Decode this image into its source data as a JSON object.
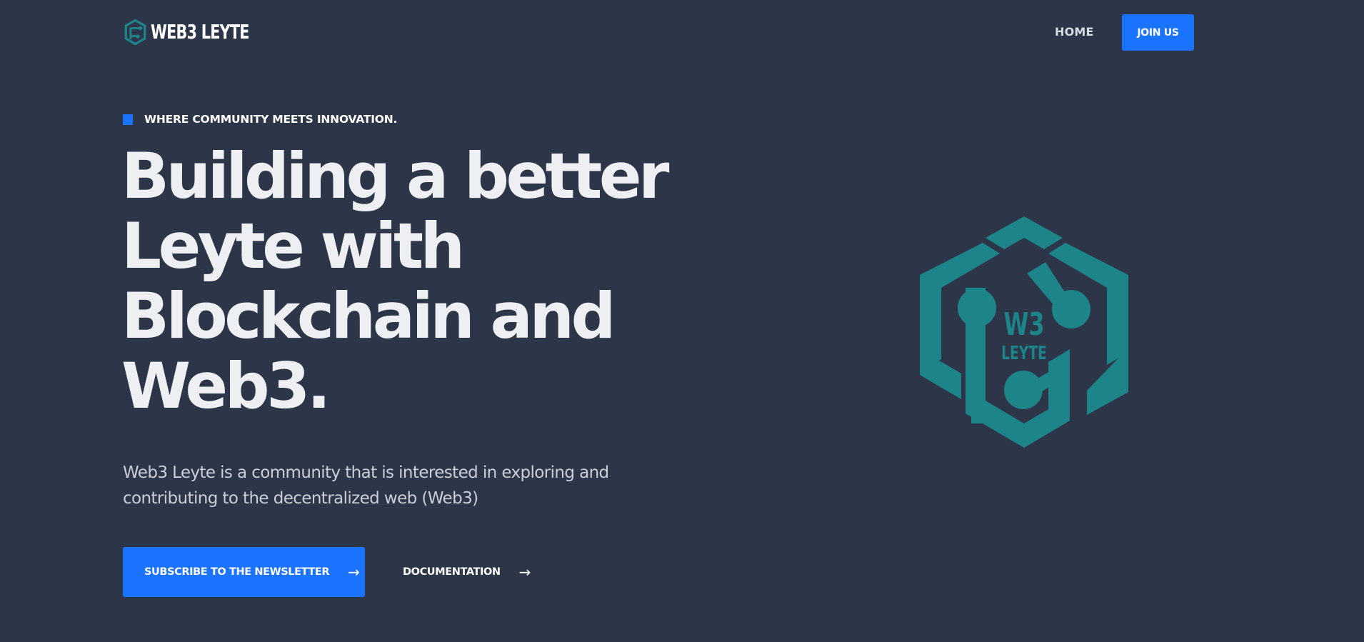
{
  "nav": {
    "brand": "WEB3 LEYTE",
    "home_label": "HOME",
    "join_label": "JOIN US"
  },
  "hero": {
    "eyebrow": "WHERE COMMUNITY MEETS INNOVATION.",
    "headline_lines": [
      "Building a better",
      "Leyte with",
      "Blockchain and",
      "Web3."
    ],
    "lead_lines": [
      "Web3 Leyte is a community that is interested in exploring and",
      "contributing to the decentralized web (Web3)"
    ],
    "subscribe_label": "SUBSCRIBE TO THE NEWSLETTER",
    "docs_label": "DOCUMENTATION",
    "arrow_glyph": "→",
    "logo_text_top": "W3",
    "logo_text_bottom": "LEYTE"
  },
  "colors": {
    "background": "#2d3648",
    "accent": "#1a74ff",
    "logo_teal": "#1d8489",
    "text": "#eef0f4"
  },
  "icons": {
    "nav_logo": "web3-leyte-hexagon-icon",
    "hero_logo": "web3-leyte-hexagon-logo",
    "eyebrow": "blue-square-bullet-icon",
    "arrow": "arrow-right-icon"
  }
}
